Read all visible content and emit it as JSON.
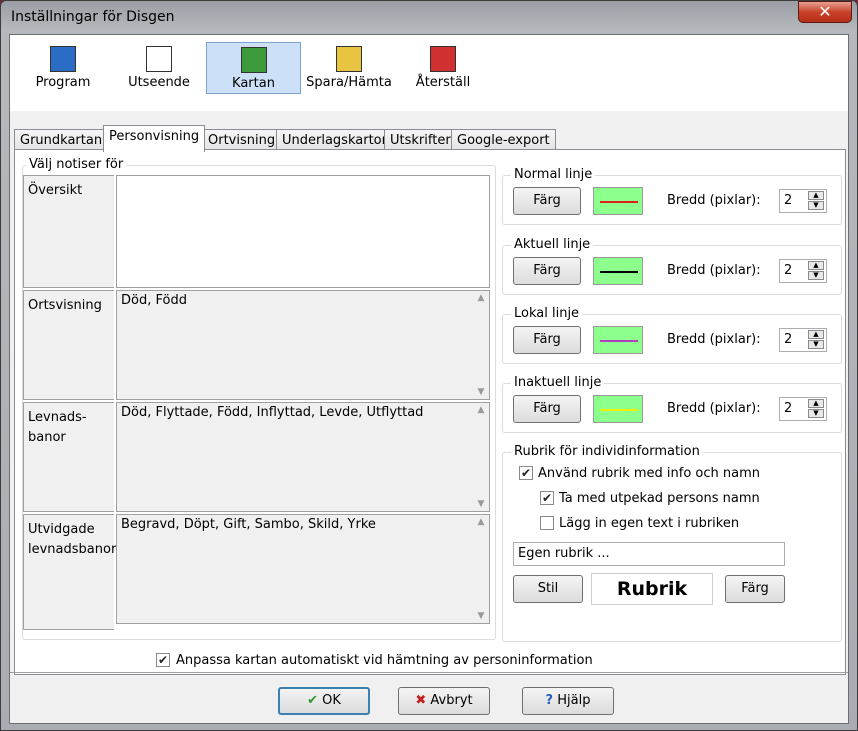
{
  "window": {
    "title": "Inställningar för Disgen",
    "close": "✕"
  },
  "toolbar": [
    {
      "label": "Program",
      "icon": "gear-icon",
      "color": "#2b6cc4"
    },
    {
      "label": "Utseende",
      "icon": "font-color-icon",
      "color": "#6aa0e8"
    },
    {
      "label": "Kartan",
      "icon": "map-icon",
      "color": "#3c9a3c"
    },
    {
      "label": "Spara/Hämta",
      "icon": "folder-icon",
      "color": "#e8c440"
    },
    {
      "label": "Återställ",
      "icon": "undo-icon",
      "color": "#d03030"
    }
  ],
  "tabs": [
    "Grundkartan",
    "Personvisning",
    "Ortvisning",
    "Underlagskartor",
    "Utskrifter",
    "Google-export"
  ],
  "left": {
    "group_label": "Välj notiser för",
    "rows": [
      {
        "label": "Översikt",
        "value": ""
      },
      {
        "label": "Ortsvisning",
        "value": "Död, Född"
      },
      {
        "label": "Levnads-\nbanor",
        "value": "Död, Flyttade, Född, Inflyttad, Levde, Utflyttad"
      },
      {
        "label": "Utvidgade\nlevnadsbanor",
        "value": "Begravd, Döpt, Gift, Sambo, Skild, Yrke"
      }
    ]
  },
  "lines": [
    {
      "label": "Normal linje",
      "button": "Färg",
      "width_label": "Bredd (pixlar):",
      "width": "2",
      "line_color": "#e02020"
    },
    {
      "label": "Aktuell linje",
      "button": "Färg",
      "width_label": "Bredd (pixlar):",
      "width": "2",
      "line_color": "#000000"
    },
    {
      "label": "Lokal linje",
      "button": "Färg",
      "width_label": "Bredd (pixlar):",
      "width": "2",
      "line_color": "#b040c0"
    },
    {
      "label": "Inaktuell linje",
      "button": "Färg",
      "width_label": "Bredd (pixlar):",
      "width": "2",
      "line_color": "#f0f000"
    }
  ],
  "rubrik": {
    "group_label": "Rubrik för individinformation",
    "cb1": "Använd rubrik med info och namn",
    "cb2": "Ta med utpekad persons namn",
    "cb3": "Lägg in egen text i rubriken",
    "custom": "Egen rubrik ...",
    "style_button": "Stil",
    "preview": "Rubrik",
    "color_button": "Färg"
  },
  "auto_fit": "Anpassa kartan automatiskt vid hämtning av personinformation",
  "buttons": {
    "ok": "OK",
    "cancel": "Avbryt",
    "help": "Hjälp"
  }
}
